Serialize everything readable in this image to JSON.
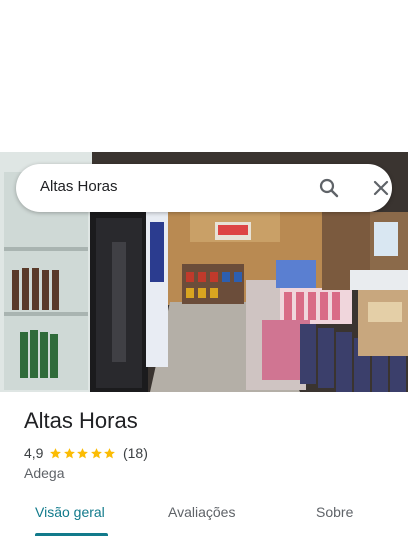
{
  "search": {
    "query": "Altas Horas"
  },
  "place": {
    "name": "Altas Horas",
    "rating": "4,9",
    "stars": 5,
    "review_count": "(18)",
    "category": "Adega"
  },
  "tabs": [
    {
      "label": "Visão geral",
      "active": true
    },
    {
      "label": "Avaliações",
      "active": false
    },
    {
      "label": "Sobre",
      "active": false
    }
  ],
  "colors": {
    "accent": "#117a8b",
    "star": "#fbbc04"
  },
  "icons": {
    "search": "search-icon",
    "close": "close-icon",
    "star": "star-icon"
  }
}
